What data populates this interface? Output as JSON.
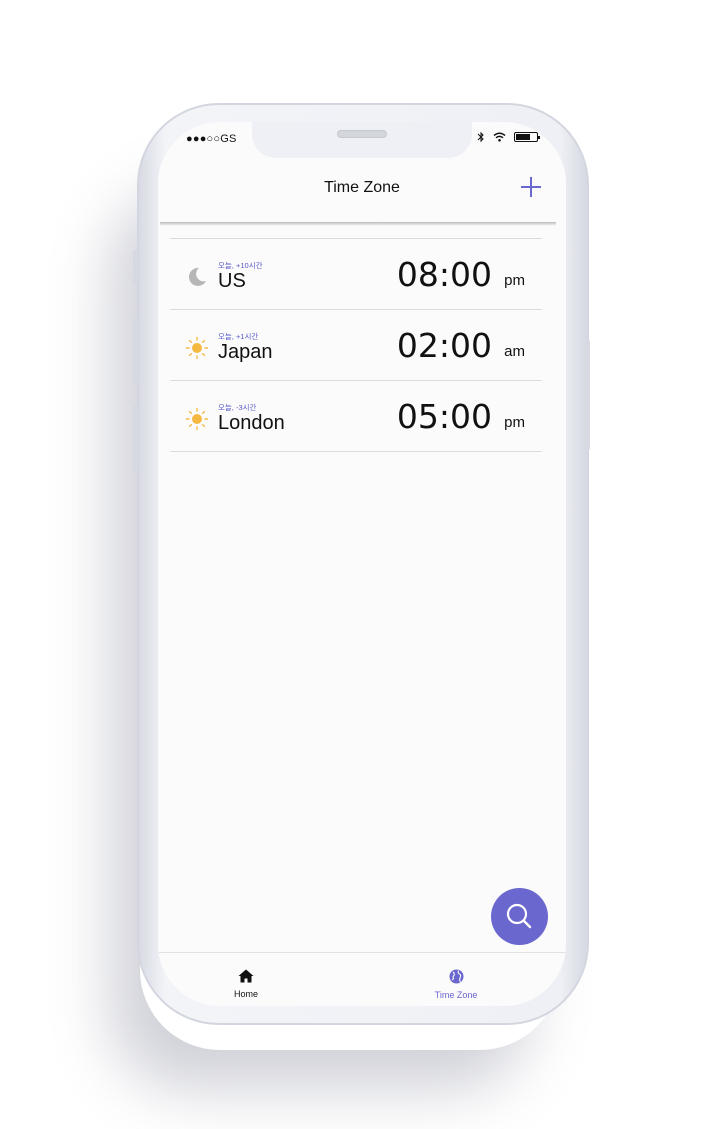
{
  "status_bar": {
    "carrier": "●●●○○GS"
  },
  "header": {
    "title": "Time Zone"
  },
  "zones": [
    {
      "city": "US",
      "offset": "오늘, +10시간",
      "time": "08:00",
      "ampm": "pm",
      "icon": "moon-icon"
    },
    {
      "city": "Japan",
      "offset": "오늘, +1시간",
      "time": "02:00",
      "ampm": "am",
      "icon": "sun-icon"
    },
    {
      "city": "London",
      "offset": "오늘, -3시간",
      "time": "05:00",
      "ampm": "pm",
      "icon": "sun-icon"
    }
  ],
  "tabs": {
    "home": "Home",
    "timezone": "Time Zone"
  },
  "colors": {
    "accent": "#6a67cf",
    "sun": "#f5b942",
    "moon": "#b7b7b7"
  }
}
